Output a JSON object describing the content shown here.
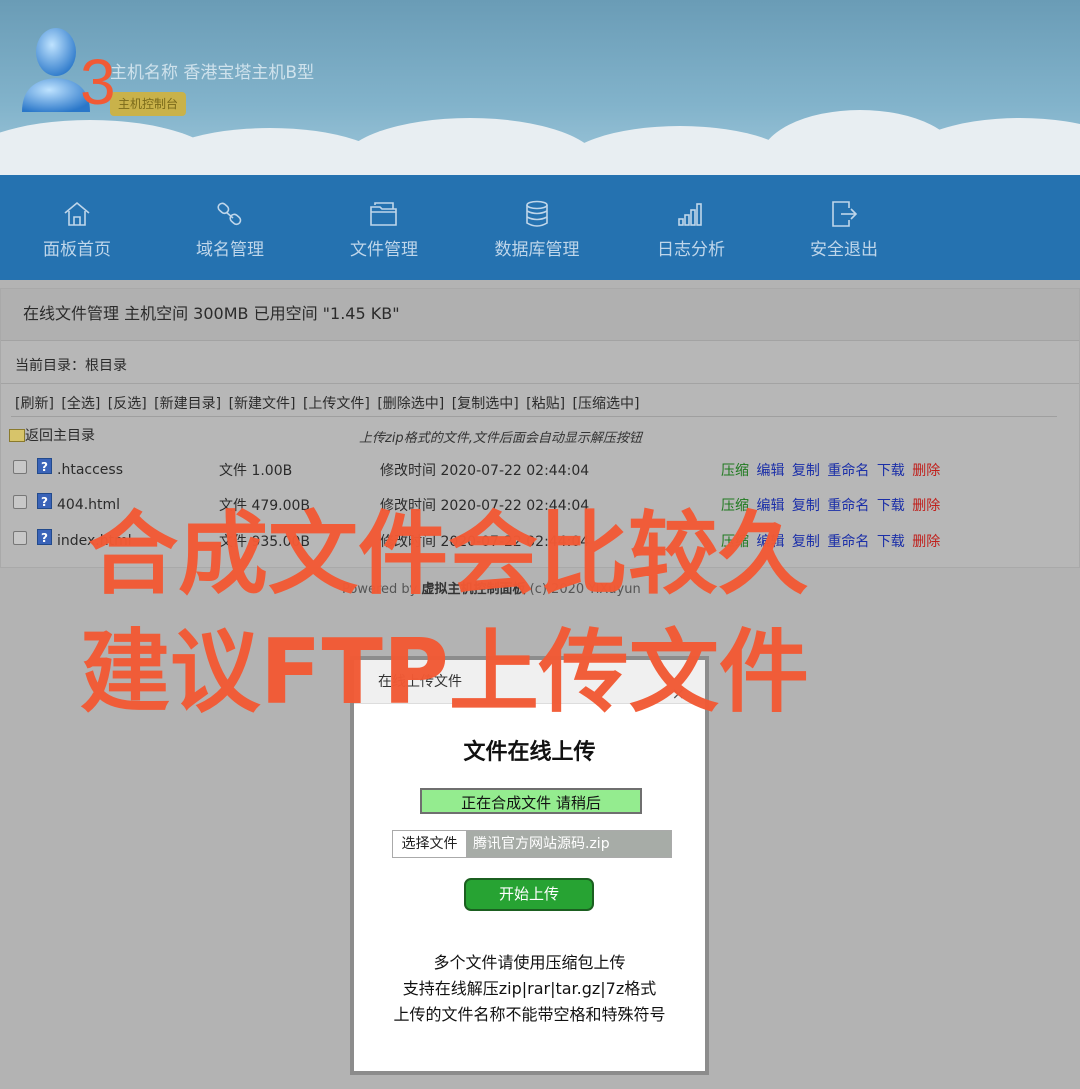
{
  "header": {
    "host_label": "主机名称 香港宝塔主机B型",
    "console_badge": "主机控制台",
    "annotation_number": "3"
  },
  "nav": {
    "items": [
      {
        "label": "面板首页",
        "icon": "home-icon"
      },
      {
        "label": "域名管理",
        "icon": "link-icon"
      },
      {
        "label": "文件管理",
        "icon": "folder-icon"
      },
      {
        "label": "数据库管理",
        "icon": "database-icon"
      },
      {
        "label": "日志分析",
        "icon": "bar-chart-icon"
      },
      {
        "label": "安全退出",
        "icon": "logout-icon"
      }
    ]
  },
  "panel": {
    "title": "在线文件管理 主机空间 300MB 已用空间 \"1.45 KB\"",
    "current_dir": "当前目录：根目录",
    "toolbar": [
      "[刷新]",
      "[全选]",
      "[反选]",
      "[新建目录]",
      "[新建文件]",
      "[上传文件]",
      "[删除选中]",
      "[复制选中]",
      "[粘贴]",
      "[压缩选中]"
    ],
    "back_label": "返回主目录",
    "zip_hint": "上传zip格式的文件,文件后面会自动显示解压按钮",
    "files": [
      {
        "name": ".htaccess",
        "size": "文件 1.00B",
        "modified": "修改时间 2020-07-22 02:44:04"
      },
      {
        "name": "404.html",
        "size": "文件 479.00B",
        "modified": "修改时间 2020-07-22 02:44:04"
      },
      {
        "name": "index.html",
        "size": "文件 935.00B",
        "modified": "修改时间 2020-07-22 02:44:04"
      }
    ],
    "actions": {
      "zip": "压缩",
      "edit": "编辑",
      "copy": "复制",
      "rename": "重命名",
      "download": "下载",
      "delete": "删除"
    },
    "powered_prefix": "Powered by ",
    "powered_brand": "虚拟主机控制面板",
    "powered_suffix": " (c) 2020 YiXuyun"
  },
  "modal": {
    "header": "在线上传文件",
    "close": "×",
    "title": "文件在线上传",
    "status": "正在合成文件 请稍后",
    "choose_button": "选择文件",
    "chosen_file": "腾讯官方网站源码.zip",
    "upload_button": "开始上传",
    "notes": [
      "多个文件请使用压缩包上传",
      "支持在线解压zip|rar|tar.gz|7z格式",
      "上传的文件名称不能带空格和特殊符号"
    ]
  },
  "annotation": {
    "line1": "合成文件会比较久",
    "line2": "建议FTP上传文件",
    "color": "#f25a35"
  }
}
